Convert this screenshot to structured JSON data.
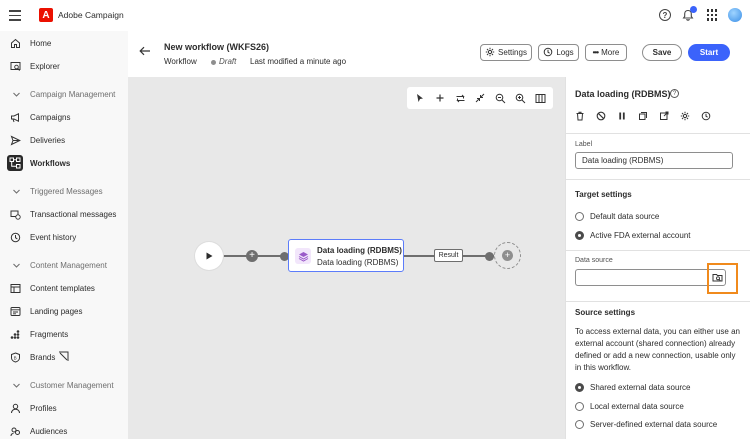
{
  "app": {
    "name": "Adobe Campaign",
    "logo_letter": "A",
    "brand_color": "#eb1000",
    "accent_color": "#3b63fb"
  },
  "topbar_icons": [
    "help-icon",
    "bell-icon",
    "apps-icon",
    "avatar"
  ],
  "sidebar": {
    "items": [
      {
        "label": "Home",
        "icon": "home-icon",
        "type": "item"
      },
      {
        "label": "Explorer",
        "icon": "explorer-icon",
        "type": "item"
      },
      {
        "label": "Campaign Management",
        "icon": "chevron-down-icon",
        "type": "section"
      },
      {
        "label": "Campaigns",
        "icon": "campaigns-icon",
        "type": "item"
      },
      {
        "label": "Deliveries",
        "icon": "send-icon",
        "type": "item"
      },
      {
        "label": "Workflows",
        "icon": "workflow-icon",
        "type": "item",
        "active": true
      },
      {
        "label": "Triggered Messages",
        "icon": "chevron-down-icon",
        "type": "section"
      },
      {
        "label": "Transactional messages",
        "icon": "transactional-icon",
        "type": "item"
      },
      {
        "label": "Event history",
        "icon": "history-icon",
        "type": "item"
      },
      {
        "label": "Content Management",
        "icon": "chevron-down-icon",
        "type": "section"
      },
      {
        "label": "Content templates",
        "icon": "template-icon",
        "type": "item"
      },
      {
        "label": "Landing pages",
        "icon": "landing-page-icon",
        "type": "item"
      },
      {
        "label": "Fragments",
        "icon": "fragments-icon",
        "type": "item"
      },
      {
        "label": "Brands",
        "icon": "brands-icon",
        "type": "item"
      },
      {
        "label": "Customer Management",
        "icon": "chevron-down-icon",
        "type": "section"
      },
      {
        "label": "Profiles",
        "icon": "profile-icon",
        "type": "item"
      },
      {
        "label": "Audiences",
        "icon": "audiences-icon",
        "type": "item"
      }
    ]
  },
  "header": {
    "title": "New workflow (WKFS26)",
    "type": "Workflow",
    "status": "Draft",
    "modified": "Last modified a minute ago",
    "buttons": {
      "settings": "Settings",
      "logs": "Logs",
      "more": "More",
      "save": "Save",
      "start": "Start"
    }
  },
  "canvas": {
    "toolbar": [
      "pointer-icon",
      "add-icon",
      "flip-icon",
      "collapse-icon",
      "zoom-out-icon",
      "zoom-in-icon",
      "minimap-icon"
    ],
    "activity": {
      "title": "Data loading (RDBMS)",
      "subtitle": "Data loading (RDBMS)"
    },
    "result_label": "Result"
  },
  "panel": {
    "title": "Data loading (RDBMS)",
    "label_caption": "Label",
    "label_value": "Data loading (RDBMS)",
    "target_settings": "Target settings",
    "target_options": [
      {
        "label": "Default data source",
        "selected": false
      },
      {
        "label": "Active FDA external account",
        "selected": true
      }
    ],
    "data_source_caption": "Data source",
    "data_source_value": "",
    "source_settings": "Source settings",
    "source_description": "To access external data, you can either use an external account (shared connection) already defined or add a new connection, usable only in this workflow.",
    "source_options": [
      {
        "label": "Shared external data source",
        "selected": true
      },
      {
        "label": "Local external data source",
        "selected": false
      },
      {
        "label": "Server-defined external data source",
        "selected": false
      }
    ]
  }
}
